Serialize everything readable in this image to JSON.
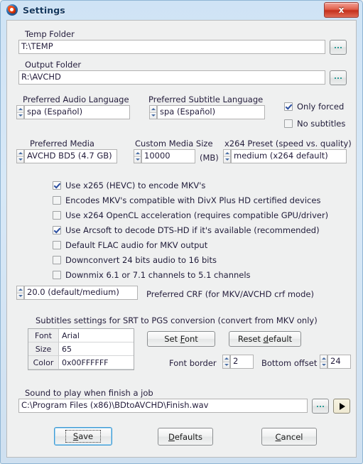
{
  "window": {
    "title": "Settings",
    "icon": "app-sphere-icon",
    "close_label": "x",
    "accent": "#3c99d4",
    "titlebar_color": "#cfe3f5",
    "panel_bg": "#eff0f0"
  },
  "temp_folder": {
    "label": "Temp Folder",
    "value": "T:\\TEMP",
    "browse_label": "..."
  },
  "output_folder": {
    "label": "Output Folder",
    "value": "R:\\AVCHD",
    "browse_label": "..."
  },
  "audio_language": {
    "label": "Preferred Audio Language",
    "value": "spa (Español)"
  },
  "subtitle_language": {
    "label": "Preferred Subtitle Language",
    "value": "spa (Español)"
  },
  "subtitle_flags": [
    {
      "label": "Only forced",
      "checked": true
    },
    {
      "label": "No subtitles",
      "checked": false
    }
  ],
  "preferred_media": {
    "label": "Preferred Media",
    "value": "AVCHD BD5 (4.7 GB)"
  },
  "custom_media_size": {
    "label": "Custom Media Size",
    "value": "10000",
    "unit": "(MB)"
  },
  "x264_preset": {
    "label": "x264 Preset (speed vs. quality)",
    "value": "medium (x264 default)"
  },
  "encoding_options": [
    {
      "label": "Use x265 (HEVC) to encode MKV's",
      "checked": true
    },
    {
      "label": "Encodes MKV's compatible with DivX Plus HD certified devices",
      "checked": false
    },
    {
      "label": "Use x264 OpenCL acceleration (requires compatible GPU/driver)",
      "checked": false
    },
    {
      "label": "Use Arcsoft to decode DTS-HD if it's available (recommended)",
      "checked": true
    },
    {
      "label": "Default FLAC audio for MKV output",
      "checked": false
    },
    {
      "label": "Downconvert 24 bits audio to 16 bits",
      "checked": false
    },
    {
      "label": "Downmix 6.1 or 7.1 channels to 5.1 channels",
      "checked": false
    }
  ],
  "crf": {
    "value": "20.0 (default/medium)",
    "label": "Preferred CRF (for MKV/AVCHD crf mode)"
  },
  "subtitles_section": {
    "heading": "Subtitles settings for SRT to PGS conversion (convert from MKV only)",
    "rows": [
      {
        "key": "Font",
        "value": "Arial"
      },
      {
        "key": "Size",
        "value": "65"
      },
      {
        "key": "Color",
        "value": "0x00FFFFFF"
      }
    ],
    "set_font_pre": "Set ",
    "set_font_accel": "F",
    "set_font_post": "ont",
    "reset_pre": "Reset ",
    "reset_accel": "d",
    "reset_post": "efault",
    "font_border_label": "Font border",
    "font_border_value": "2",
    "bottom_offset_label": "Bottom offset",
    "bottom_offset_value": "24"
  },
  "sound": {
    "label": "Sound to play when finish a job",
    "value": "C:\\Program Files (x86)\\BDtoAVCHD\\Finish.wav",
    "browse_label": "...",
    "play_label": "play-icon"
  },
  "actions": {
    "save_accel": "S",
    "save_post": "ave",
    "defaults_accel": "D",
    "defaults_post": "efaults",
    "cancel_accel": "C",
    "cancel_post": "ancel"
  }
}
